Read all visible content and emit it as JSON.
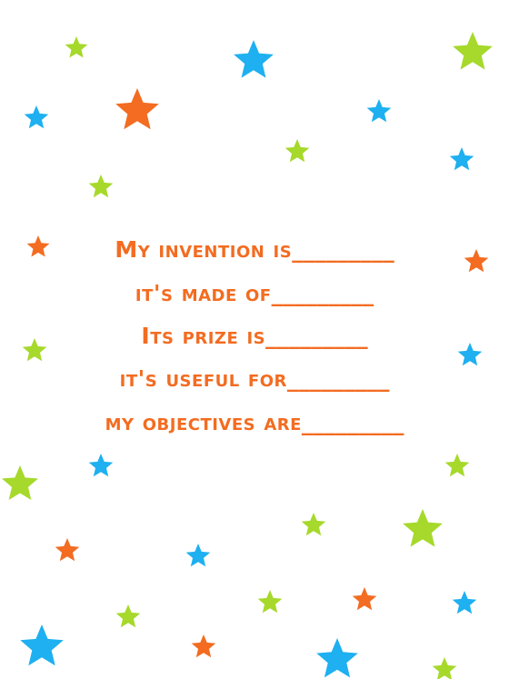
{
  "colors": {
    "orange": "#f36c21",
    "blue": "#1eb0f0",
    "green": "#a6d92b"
  },
  "worksheet": {
    "lines": [
      {
        "text": "My invention is",
        "blank": "_________"
      },
      {
        "text": "it's made of",
        "blank": "_________"
      },
      {
        "text": "Its prize is",
        "blank": "_________"
      },
      {
        "text": "it's useful for",
        "blank": "_________"
      },
      {
        "text": "my objectives are",
        "blank": "_________"
      }
    ]
  },
  "decoration": {
    "icon": "star-icon",
    "count": 32
  }
}
